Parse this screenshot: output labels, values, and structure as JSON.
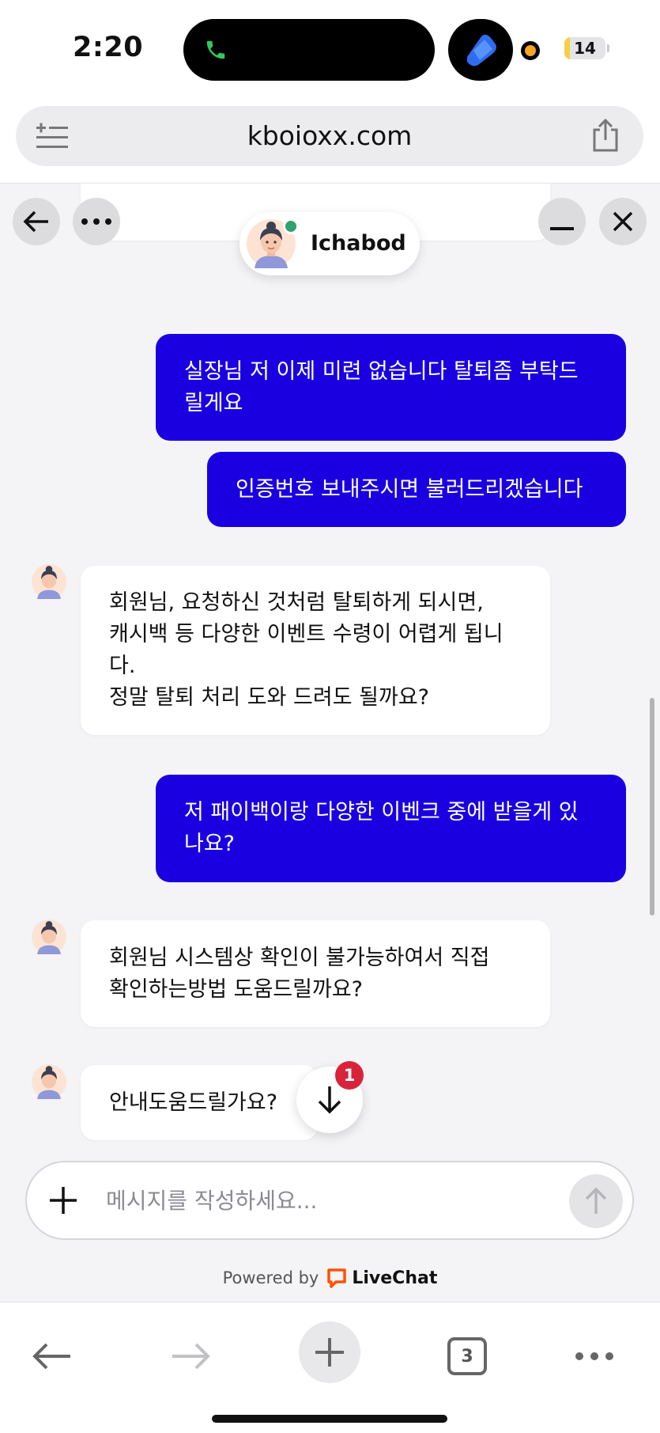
{
  "status_bar": {
    "time": "2:20",
    "battery_level": 14,
    "battery_label": "14"
  },
  "browser": {
    "url": "kboioxx.com",
    "tab_count": "3"
  },
  "chat": {
    "agent_name": "Ichabod",
    "agent_status": "online",
    "messages": [
      {
        "from": "visitor",
        "lines": [
          "실장님 저 이제 미련 없습니다 탈퇴좀 부탁드",
          "릴게요"
        ]
      },
      {
        "from": "visitor",
        "lines": [
          "인증번호 보내주시면 불러드리겠습니다"
        ]
      },
      {
        "from": "agent",
        "lines": [
          "회원님, 요청하신 것처럼 탈퇴하게 되시면,",
          "캐시백 등 다양한 이벤트 수령이 어렵게 됩니",
          "다.",
          "정말 탈퇴 처리 도와 드려도 될까요?"
        ]
      },
      {
        "from": "visitor",
        "lines": [
          "저 패이백이랑 다양한 이벤크 중에 받을게 있",
          "나요?"
        ]
      },
      {
        "from": "agent",
        "lines": [
          "회원님 시스템상 확인이 불가능하여서 직접",
          "확인하는방법 도움드릴까요?"
        ]
      },
      {
        "from": "agent",
        "lines": [
          "안내도움드릴가요?"
        ]
      }
    ],
    "unread_count": "1",
    "composer_placeholder": "메시지를 작성하세요...",
    "powered_by": "Powered by",
    "brand": "LiveChat"
  },
  "colors": {
    "visitor_bubble": "#1a00e0",
    "chat_background": "#f4f4f6",
    "badge": "#d8243a",
    "online": "#2fa36b",
    "brand_orange": "#ff5100"
  },
  "icons": [
    "phone-icon",
    "app-icon",
    "menu-lines-icon",
    "share-icon",
    "back-arrow-icon",
    "more-icon",
    "minimize-icon",
    "close-icon",
    "arrow-down-icon",
    "plus-icon",
    "send-arrow-icon",
    "livechat-logo-icon",
    "forward-arrow-icon",
    "tabs-icon"
  ]
}
